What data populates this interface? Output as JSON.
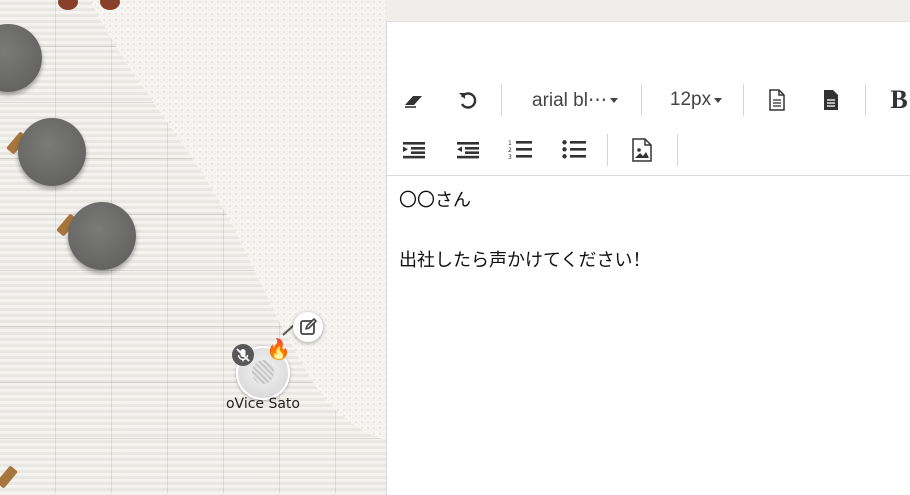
{
  "canvas": {
    "user": {
      "name": "oVice Sato",
      "status_emoji": "🔥",
      "muted": true
    }
  },
  "editor": {
    "toolbar": {
      "eraser_icon": "eraser-icon",
      "undo_icon": "undo-icon",
      "font_family": "arial bl⋯",
      "font_size": "12px",
      "bold_label": "B"
    },
    "content": {
      "lines": [
        "〇〇さん",
        "",
        "出社したら声かけてください！"
      ]
    }
  },
  "colors": {
    "table": "#686866",
    "chair": "#a8763d",
    "panel_bg": "#ffffff",
    "icon": "#333333"
  }
}
